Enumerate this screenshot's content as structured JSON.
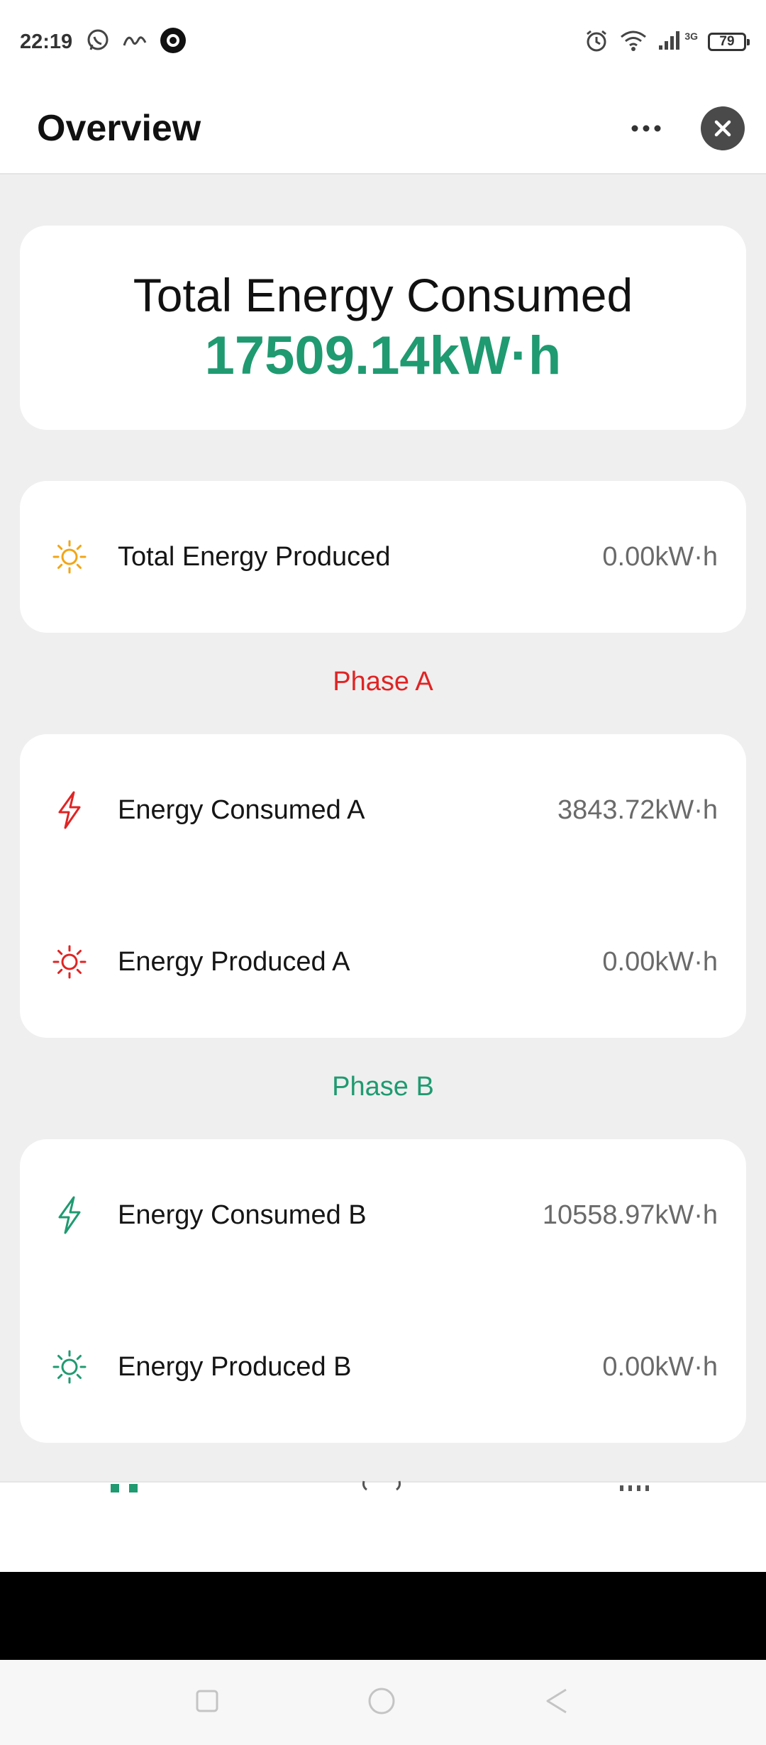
{
  "status_bar": {
    "time": "22:19",
    "network": "3G",
    "battery": "79"
  },
  "header": {
    "title": "Overview"
  },
  "total_consumed": {
    "label": "Total Energy Consumed",
    "value": "17509.14kW·h"
  },
  "total_produced": {
    "label": "Total Energy Produced",
    "value": "0.00kW·h"
  },
  "phases": [
    {
      "title": "Phase A",
      "color": "#e02424",
      "consumed_label": "Energy Consumed A",
      "consumed_value": "3843.72kW·h",
      "produced_label": "Energy Produced A",
      "produced_value": "0.00kW·h"
    },
    {
      "title": "Phase B",
      "color": "#1f9a71",
      "consumed_label": "Energy Consumed B",
      "consumed_value": "10558.97kW·h",
      "produced_label": "Energy Produced B",
      "produced_value": "0.00kW·h"
    }
  ],
  "colors": {
    "accent": "#1f9a71",
    "phase_a": "#e02424",
    "sun_yellow": "#f2a516",
    "value_gray": "#6a6a6a"
  },
  "icons": {
    "produced": "sun-icon",
    "consumed": "lightning-icon"
  }
}
